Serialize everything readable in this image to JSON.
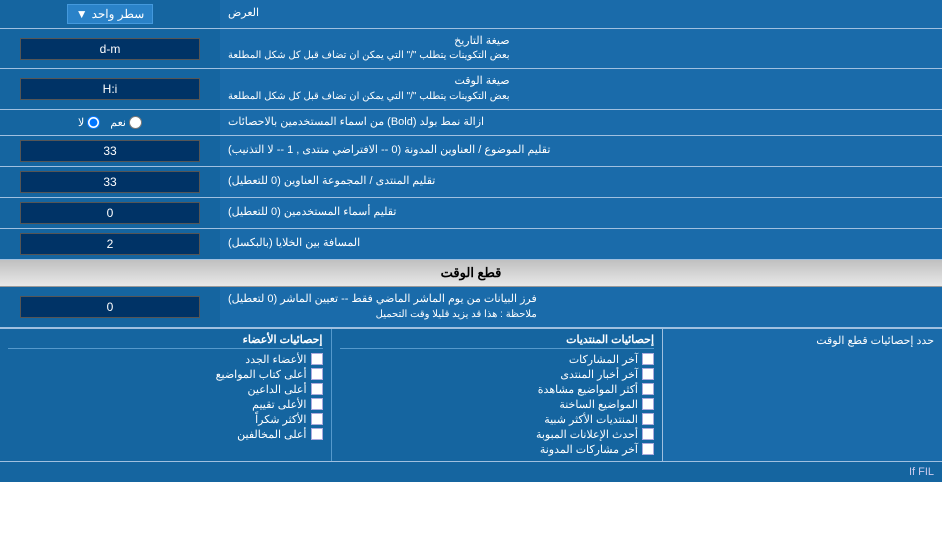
{
  "header": {
    "title": "العرض",
    "dropdown_label": "سطر واحد"
  },
  "rows": [
    {
      "id": "date-format",
      "label": "صيغة التاريخ",
      "sub_label": "بعض التكوينات يتطلب \"/\" التي يمكن ان تضاف قبل كل شكل المطلعة",
      "value": "d-m",
      "type": "input"
    },
    {
      "id": "time-format",
      "label": "صيغة الوقت",
      "sub_label": "بعض التكوينات يتطلب \"/\" التي يمكن ان تضاف قبل كل شكل المطلعة",
      "value": "H:i",
      "type": "input"
    },
    {
      "id": "bold-remove",
      "label": "ازالة نمط بولد (Bold) من اسماء المستخدمين بالاحصائات",
      "value_yes": "نعم",
      "value_no": "لا",
      "selected": "no",
      "type": "radio"
    },
    {
      "id": "topic-title",
      "label": "تقليم الموضوع / العناوين المدونة (0 -- الافتراضي منتدى , 1 -- لا التذنيب)",
      "value": "33",
      "type": "input"
    },
    {
      "id": "forum-group",
      "label": "تقليم المنتدى / المجموعة العناوين (0 للتعطيل)",
      "value": "33",
      "type": "input"
    },
    {
      "id": "user-names",
      "label": "تقليم أسماء المستخدمين (0 للتعطيل)",
      "value": "0",
      "type": "input"
    },
    {
      "id": "gap-between",
      "label": "المسافة بين الخلايا (بالبكسل)",
      "value": "2",
      "type": "input"
    }
  ],
  "section_cutoff": {
    "title": "قطع الوقت",
    "cutoff_row": {
      "label": "فرز البيانات من يوم الماشر الماضي فقط -- تعيين الماشر (0 لتعطيل)",
      "sub_label": "ملاحظة : هذا قد يزيد قليلا وقت التحميل",
      "value": "0"
    }
  },
  "stats_section": {
    "label": "حدد إحصائيات قطع الوقت",
    "col1_header": "إحصائيات المنتديات",
    "col1_items": [
      "آخر المشاركات",
      "آخر أخبار المنتدى",
      "أكثر المواضيع مشاهدة",
      "المواضيع الساخنة",
      "المنتديات الأكثر شبية",
      "أحدث الإعلانات المبوبة",
      "آخر مشاركات المدونة"
    ],
    "col2_header": "إحصائيات الأعضاء",
    "col2_items": [
      "الأعضاء الجدد",
      "أعلى كتاب المواضيع",
      "أعلى الداعين",
      "الأعلى تقييم",
      "الأكثر شكراً",
      "أعلى المخالفين"
    ]
  },
  "bottom_note": "If FIL"
}
